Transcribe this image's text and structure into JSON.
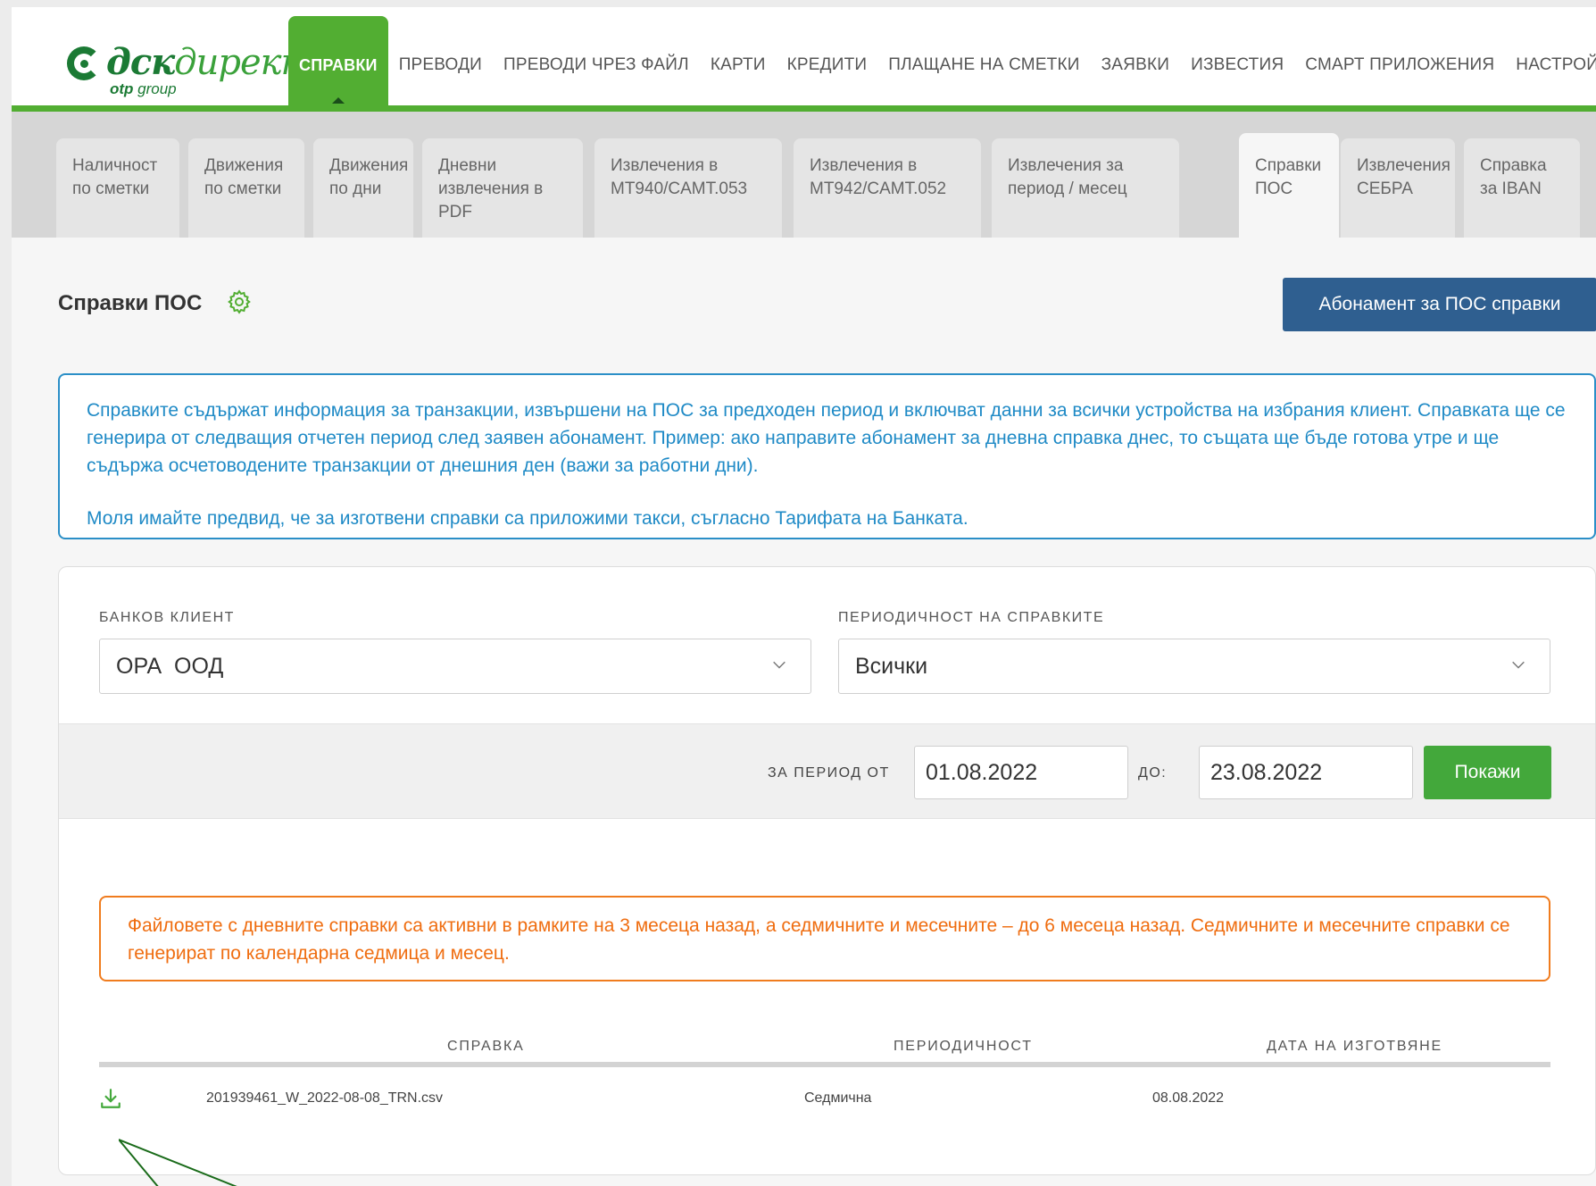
{
  "logo": {
    "brand_bold": "дск",
    "brand_thin": "директ",
    "sub_bold": "otp",
    "sub_rest": " group"
  },
  "nav": {
    "items": [
      {
        "label": "СПРАВКИ",
        "active": true
      },
      {
        "label": "ПРЕВОДИ"
      },
      {
        "label": "ПРЕВОДИ ЧРЕЗ ФАЙЛ"
      },
      {
        "label": "КАРТИ"
      },
      {
        "label": "КРЕДИТИ"
      },
      {
        "label": "ПЛАЩАНЕ НА СМЕТКИ"
      },
      {
        "label": "ЗАЯВКИ"
      },
      {
        "label": "ИЗВЕСТИЯ"
      },
      {
        "label": "СМАРТ ПРИЛОЖЕНИЯ"
      },
      {
        "label": "НАСТРОЙКИ"
      }
    ]
  },
  "subtabs": [
    {
      "line1": "Наличност",
      "line2": "по сметки"
    },
    {
      "line1": "Движения",
      "line2": "по сметки"
    },
    {
      "line1": "Движения",
      "line2": "по дни"
    },
    {
      "line1": "Дневни",
      "line2": "извлечения в",
      "line3": "PDF"
    },
    {
      "line1": "Извлечения в",
      "line2": "MT940/CAMT.053"
    },
    {
      "line1": "Извлечения в",
      "line2": "MT942/CAMT.052"
    },
    {
      "line1": "Извлечения за",
      "line2": "период / месец"
    },
    {
      "line1": "Справки",
      "line2": "ПОС",
      "active": true
    },
    {
      "line1": "Извлечения",
      "line2": "СЕБРА"
    },
    {
      "line1": "Справка",
      "line2": "за IBAN"
    }
  ],
  "page": {
    "title": "Справки ПОС",
    "settings_icon": "gear-icon",
    "subscribe_label": "Абонамент за ПОС справки"
  },
  "info": {
    "p1": "Справките съдържат информация за транзакции, извършени на ПОС за предходен период и включват данни за всички устройства на избрания клиент. Справката ще се генерира от следващия отчетен период след заявен абонамент. Пример: ако направите абонамент за дневна справка днес, то същата ще бъде готова утре и ще съдържа осчетоводените транзакции от днешния ден (важи за работни дни).",
    "p2": "Моля имайте предвид, че за изготвени справки са приложими такси, съгласно Тарифата на Банката."
  },
  "filters": {
    "client_label": "БАНКОВ КЛИЕНТ",
    "client_value": "ОРА  ООД",
    "periodicity_label": "ПЕРИОДИЧНОСТ НА СПРАВКИТЕ",
    "periodicity_value": "Всички",
    "from_label": "ЗА ПЕРИОД ОТ",
    "from_value": "01.08.2022",
    "to_label": "ДО:",
    "to_value": "23.08.2022",
    "show_label": "Покажи"
  },
  "warning": {
    "text": "Файловете с дневните справки са активни в рамките на 3 месеца назад, а седмичните и месечните – до 6 месеца назад. Седмичните и месечните справки се генерират по календарна седмица и месец."
  },
  "table": {
    "headers": {
      "report": "СПРАВКА",
      "periodicity": "ПЕРИОДИЧНОСТ",
      "date": "ДАТА НА ИЗГОТВЯНЕ"
    },
    "rows": [
      {
        "file": "201939461_W_2022-08-08_TRN.csv",
        "periodicity": "Седмична",
        "date": "08.08.2022",
        "icon": "download-icon"
      }
    ]
  },
  "colors": {
    "brand_green": "#52ae32",
    "primary_blue": "#2f5f90",
    "info_blue": "#1f8ac6",
    "warning_orange": "#ef6d10",
    "button_green": "#43a83b"
  }
}
